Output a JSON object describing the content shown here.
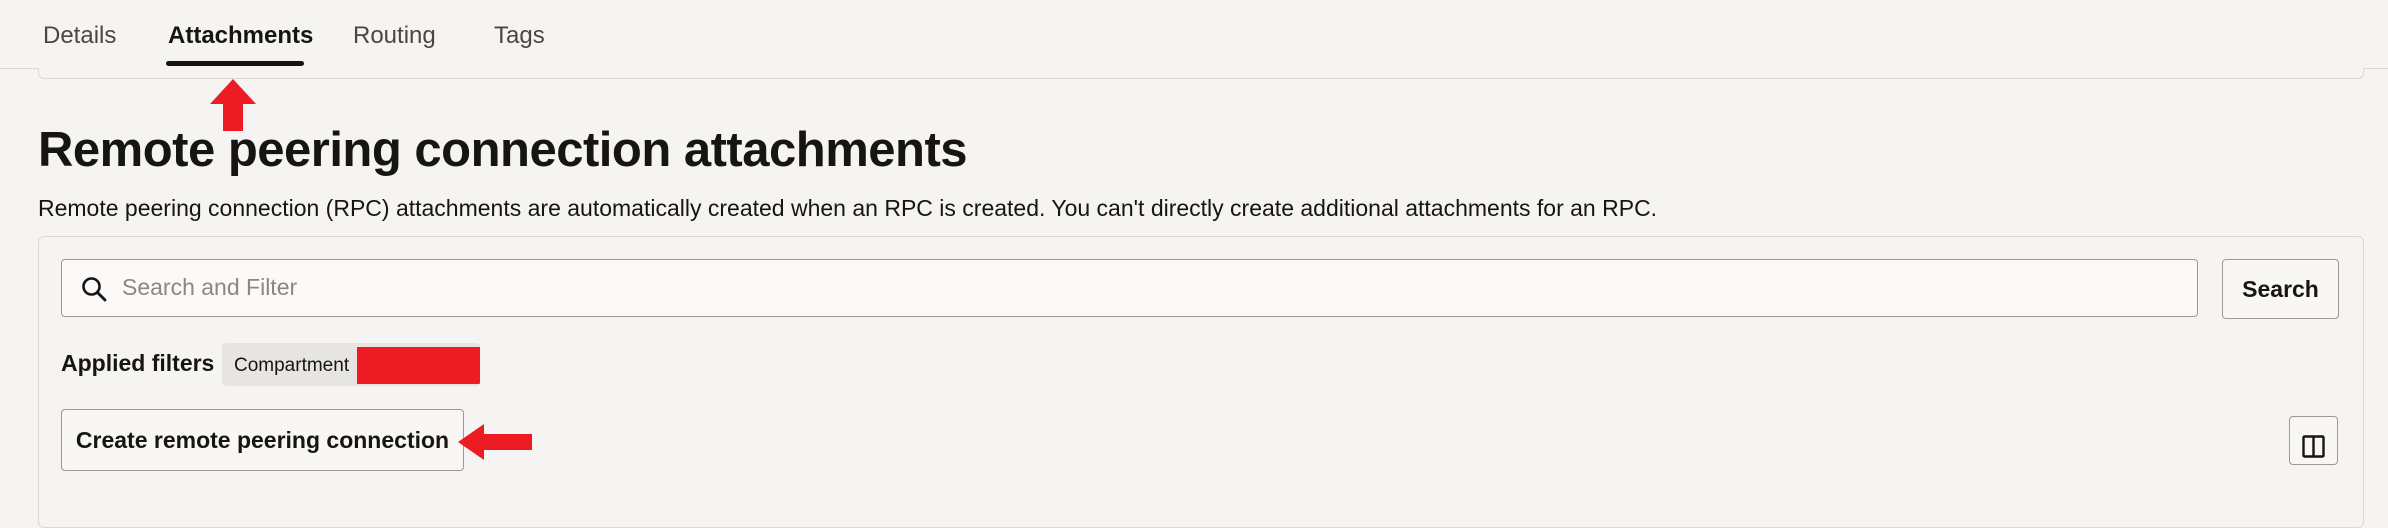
{
  "tabs": [
    {
      "label": "Details",
      "active": false
    },
    {
      "label": "Attachments",
      "active": true
    },
    {
      "label": "Routing",
      "active": false
    },
    {
      "label": "Tags",
      "active": false
    }
  ],
  "main": {
    "title": "Remote peering connection attachments",
    "description": "Remote peering connection (RPC) attachments are automatically created when an RPC is created. You can't directly create additional attachments for an RPC."
  },
  "search": {
    "placeholder": "Search and Filter",
    "value": "",
    "button_label": "Search",
    "icon": "search-icon"
  },
  "filters": {
    "label": "Applied filters",
    "chips": [
      {
        "label": "Compartment",
        "value_redacted": true
      }
    ]
  },
  "actions": {
    "create_label": "Create remote peering connection",
    "columns_icon": "columns-icon"
  },
  "colors": {
    "background": "#f5f4f2",
    "text": "#161513",
    "border": "#9e9a93",
    "annotation_red": "#ed1c24",
    "chip_bg": "#e7e5e1"
  }
}
